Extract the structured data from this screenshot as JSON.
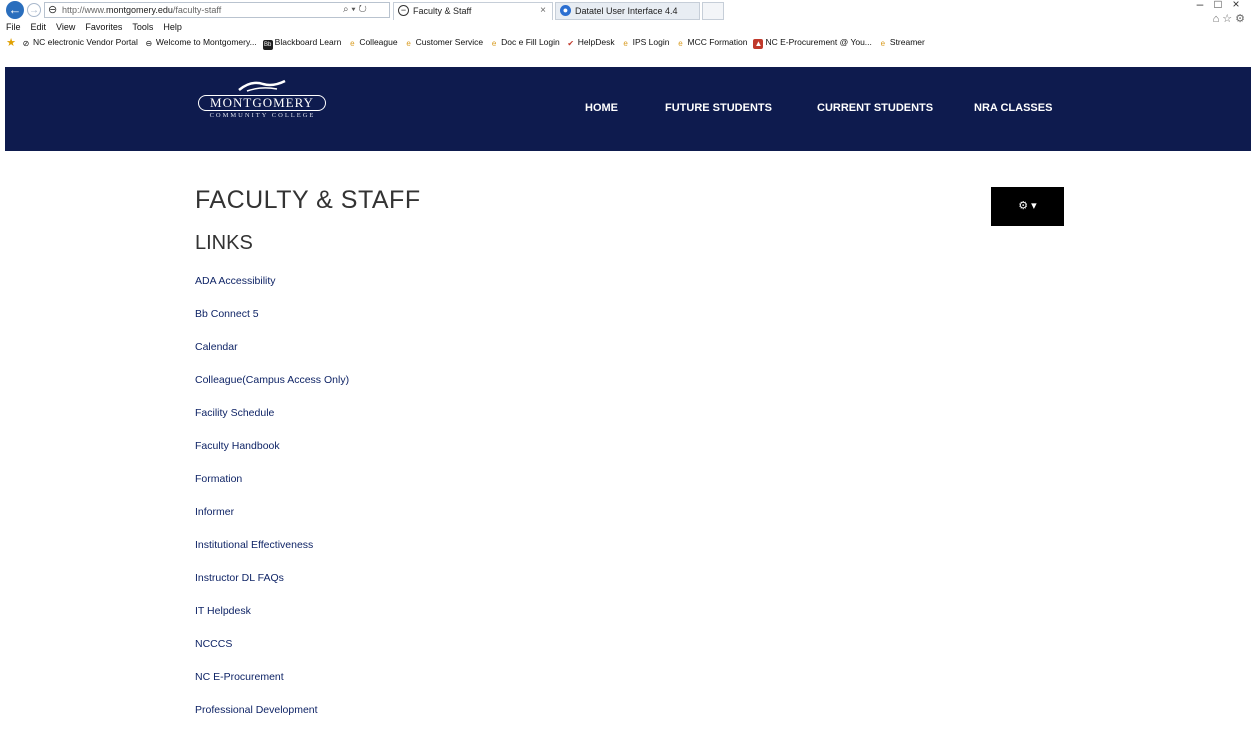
{
  "browser": {
    "url_prefix": "http://www.",
    "url_domain": "montgomery.edu",
    "url_path": "/faculty-staff",
    "address_tools": "⌕ ▾ ↻",
    "tabs": [
      {
        "label": "Faculty & Staff",
        "active": true,
        "close": "×"
      },
      {
        "label": "Datatel User Interface 4.4",
        "active": false
      }
    ],
    "window_controls": [
      "–",
      "□",
      "×"
    ],
    "menu": [
      "File",
      "Edit",
      "View",
      "Favorites",
      "Tools",
      "Help"
    ],
    "favorites": [
      {
        "label": "NC electronic Vendor Portal",
        "icon": "blocked-icon",
        "color": "#3b3b3b"
      },
      {
        "label": "Welcome to Montgomery...",
        "icon": "globe-icon",
        "color": "#3b3b3b"
      },
      {
        "label": "Blackboard Learn",
        "icon": "blackboard-icon",
        "color": "#1f1f1f"
      },
      {
        "label": "Colleague",
        "icon": "ie-page-icon",
        "color": "#d89b1f"
      },
      {
        "label": "Customer Service",
        "icon": "ie-page-icon",
        "color": "#d89b1f"
      },
      {
        "label": "Doc e Fill Login",
        "icon": "ie-page-icon",
        "color": "#d89b1f"
      },
      {
        "label": "HelpDesk",
        "icon": "checkmark-icon",
        "color": "#c0392b"
      },
      {
        "label": "IPS Login",
        "icon": "ie-page-icon",
        "color": "#d89b1f"
      },
      {
        "label": "MCC Formation",
        "icon": "ie-page-icon",
        "color": "#d89b1f"
      },
      {
        "label": "NC E-Procurement @ You...",
        "icon": "mountain-icon",
        "color": "#c0392b"
      },
      {
        "label": "Streamer",
        "icon": "ie-page-icon",
        "color": "#d89b1f"
      }
    ]
  },
  "site": {
    "logo_name": "MONTGOMERY",
    "logo_sub": "COMMUNITY COLLEGE",
    "nav": [
      "HOME",
      "FUTURE STUDENTS",
      "CURRENT STUDENTS",
      "NRA CLASSES"
    ],
    "header_color": "#0e1b4e"
  },
  "content": {
    "title": "FACULTY & STAFF",
    "links_heading": "LINKS",
    "gear_button": "⚙ ▾",
    "links": [
      "ADA Accessibility",
      "Bb Connect 5",
      "Calendar",
      "Colleague(Campus Access Only)",
      "Facility Schedule",
      "Faculty Handbook",
      "Formation",
      "Informer",
      "Institutional Effectiveness",
      "Instructor DL FAQs",
      "IT Helpdesk",
      "NCCCS",
      "NC E-Procurement",
      "Professional Development"
    ],
    "link_color": "#0f2466"
  }
}
